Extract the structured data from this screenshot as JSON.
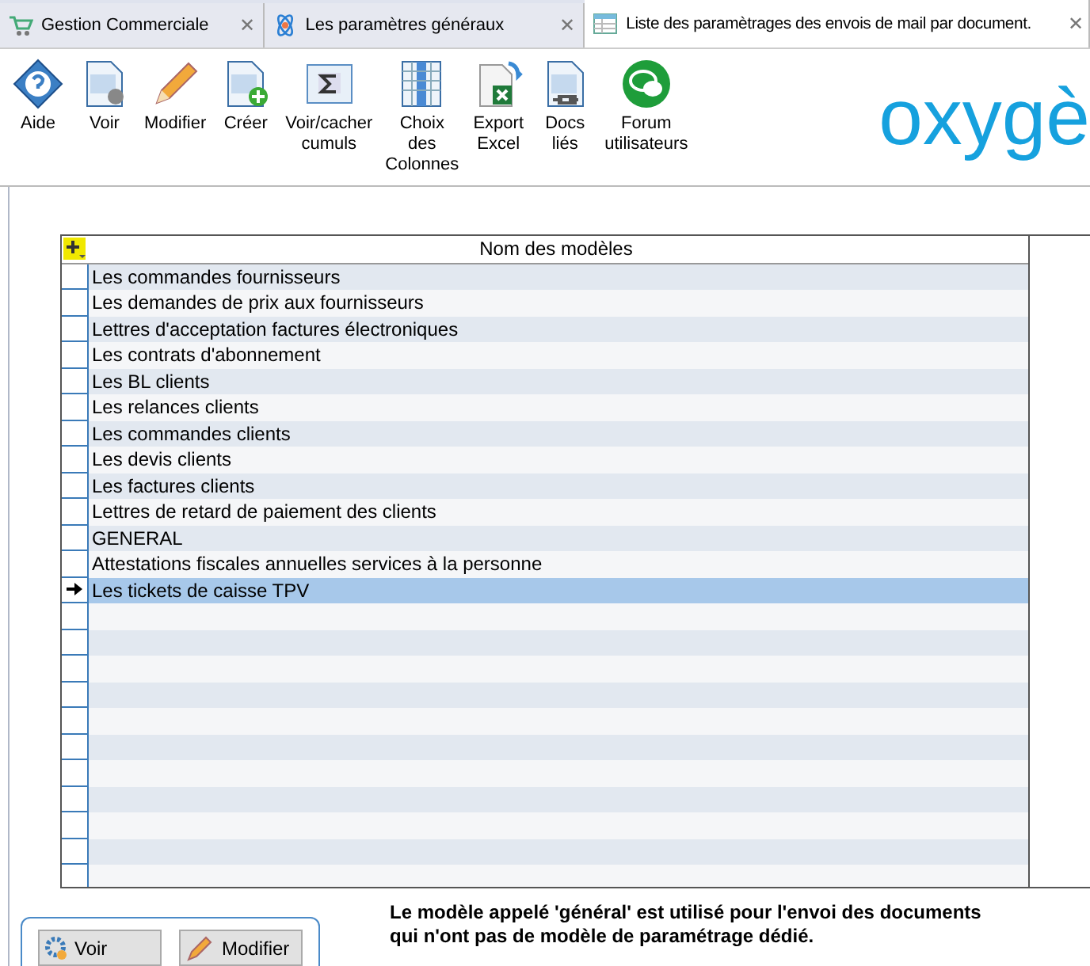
{
  "tabs": [
    {
      "label": "Gestion Commerciale",
      "selected": false,
      "close": "✕"
    },
    {
      "label": "Les paramètres généraux",
      "selected": false,
      "close": "✕"
    },
    {
      "label": "Liste des paramètrages des envois de mail par document.",
      "selected": true,
      "close": "✕"
    }
  ],
  "toolbar": [
    {
      "kind": "help",
      "label": "Aide"
    },
    {
      "kind": "view",
      "label": "Voir"
    },
    {
      "kind": "edit",
      "label": "Modifier"
    },
    {
      "kind": "create",
      "label": "Créer"
    },
    {
      "kind": "sum",
      "label": "Voir/cacher cumuls"
    },
    {
      "kind": "columns",
      "label": "Choix des Colonnes"
    },
    {
      "kind": "excel",
      "label": "Export Excel"
    },
    {
      "kind": "docs",
      "label": "Docs liés"
    },
    {
      "kind": "forum",
      "label": "Forum utilisateurs"
    }
  ],
  "logo": "oxygè",
  "table": {
    "column": "Nom des modèles",
    "rows": [
      {
        "name": "Les commandes fournisseurs",
        "selected": false
      },
      {
        "name": "Les demandes de prix aux fournisseurs",
        "selected": false
      },
      {
        "name": "Lettres d'acceptation factures électroniques",
        "selected": false
      },
      {
        "name": "Les contrats d'abonnement",
        "selected": false
      },
      {
        "name": "Les BL clients",
        "selected": false
      },
      {
        "name": "Les relances clients",
        "selected": false
      },
      {
        "name": "Les commandes clients",
        "selected": false
      },
      {
        "name": "Les devis clients",
        "selected": false
      },
      {
        "name": "Les factures clients",
        "selected": false
      },
      {
        "name": "Lettres de retard de paiement des clients",
        "selected": false
      },
      {
        "name": "GENERAL",
        "selected": false
      },
      {
        "name": "Attestations fiscales annuelles services à la personne",
        "selected": false
      },
      {
        "name": "Les tickets de caisse TPV",
        "selected": true
      }
    ]
  },
  "buttons": [
    {
      "kind": "view",
      "label": "Voir"
    },
    {
      "kind": "edit",
      "label": "Modifier"
    }
  ],
  "note": "Le modèle appelé 'général' est utilisé pour l'envoi des documents qui n'ont pas de modèle de paramétrage dédié."
}
